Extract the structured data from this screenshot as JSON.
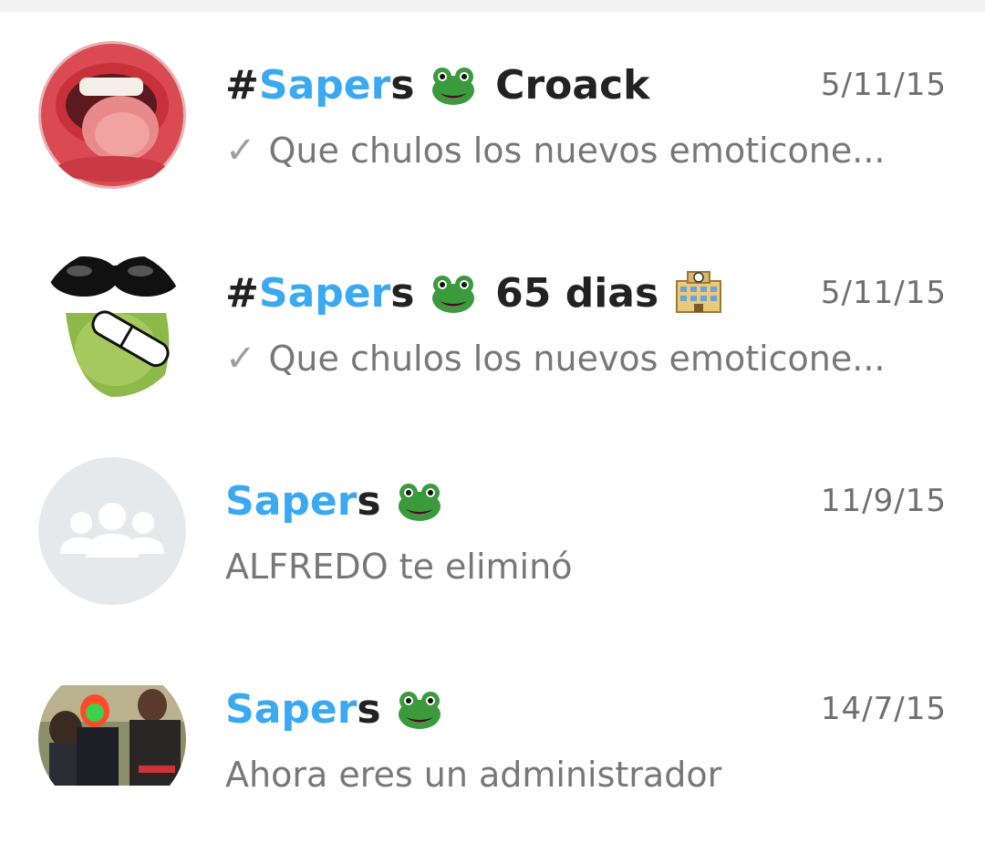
{
  "chats": [
    {
      "title_prefix": "#",
      "title_highlight": "Saper",
      "title_after": "s",
      "title_emoji": "frog-face",
      "title_suffix": "Croack",
      "title_suffix_emoji": "",
      "date": "5/11/15",
      "status_icon": "check-icon",
      "preview": "Que chulos los nuevos emoticone...",
      "avatar": "lips-tongue-photo"
    },
    {
      "title_prefix": "#",
      "title_highlight": "Saper",
      "title_after": "s",
      "title_emoji": "frog-face",
      "title_suffix": "65 dias",
      "title_suffix_emoji": "hotel-building",
      "date": "5/11/15",
      "status_icon": "check-icon",
      "preview": "Que chulos los nuevos emoticone...",
      "avatar": "frog-sunglasses-sticker"
    },
    {
      "title_prefix": "",
      "title_highlight": "Saper",
      "title_after": "s",
      "title_emoji": "frog-face",
      "title_suffix": "",
      "title_suffix_emoji": "",
      "date": "11/9/15",
      "status_icon": "",
      "preview": "ALFREDO te eliminó",
      "avatar": "default-group-icon"
    },
    {
      "title_prefix": "",
      "title_highlight": "Saper",
      "title_after": "s",
      "title_emoji": "frog-face",
      "title_suffix": "",
      "title_suffix_emoji": "",
      "date": "14/7/15",
      "status_icon": "",
      "preview": "Ahora eres un administrador",
      "avatar": "group-photo"
    }
  ],
  "check_glyph": "✓",
  "colors": {
    "title": "#222222",
    "highlight": "#3aa9f2",
    "date": "#6e6e6e",
    "preview": "#777777",
    "check": "#9e9e9e",
    "placeholder_bg": "#e6e9ec"
  }
}
